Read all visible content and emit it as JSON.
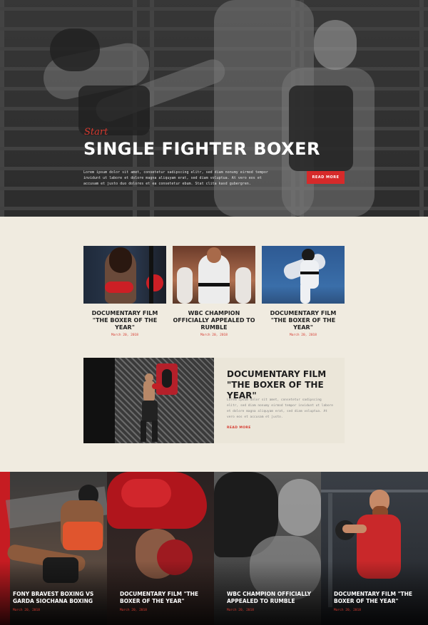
{
  "hero": {
    "script_word": "Start",
    "title": "SINGLE FIGHTER BOXER",
    "description": "Lorem ipsum dolor sit amet, consetetur sadipscing elitr, sed diam nonumy eirmod tempor invidunt ut labore et dolore magna aliquyam erat, sed diam voluptua. At vero eos et accusam et justo duo dolores et ea consetetur ebum. Stat clita kasd gubergren.",
    "button_label": "READ MORE"
  },
  "cards": [
    {
      "title": "DOCUMENTARY FILM \"THE BOXER OF THE YEAR\"",
      "date": "March 20, 2018"
    },
    {
      "title": "WBC CHAMPION OFFICIALLY APPEALED TO RUMBLE",
      "date": "March 20, 2018"
    },
    {
      "title": "DOCUMENTARY FILM \"THE BOXER OF THE YEAR\"",
      "date": "March 20, 2018"
    }
  ],
  "feature": {
    "title": "DOCUMENTARY FILM \"THE BOXER OF THE YEAR\"",
    "description": "Lorem ipsum dolor sit amet, consetetur sadipscing elitr, sed diam nonumy eirmod tempor invidunt ut labore et dolore magna aliquyam erat, sed diam voluptua. At vero eos et accusam et justo.",
    "read_more": "READ MORE"
  },
  "tiles": [
    {
      "title": "FONY BRAVEST BOXING VS GARDA SIOCHANA BOXING",
      "date": "March 20, 2018"
    },
    {
      "title": "DOCUMENTARY FILM \"THE BOXER OF THE YEAR\"",
      "date": "March 20, 2018"
    },
    {
      "title": "WBC CHAMPION OFFICIALLY APPEALED TO RUMBLE",
      "date": "March 20, 2018"
    },
    {
      "title": "DOCUMENTARY FILM \"THE BOXER OF THE YEAR\"",
      "date": "March 20, 2018"
    }
  ],
  "colors": {
    "accent": "#d62a2a",
    "background": "#f0ebe0",
    "dark": "#1a1a1a"
  }
}
